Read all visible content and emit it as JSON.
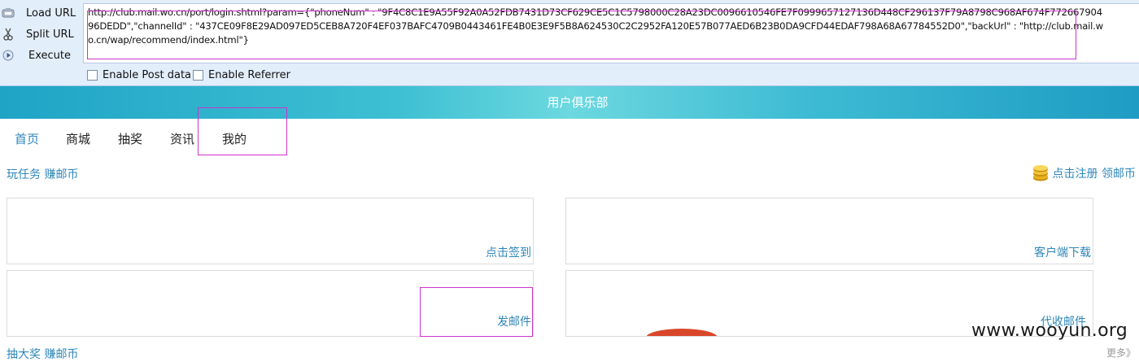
{
  "toolbar": {
    "load_url_label": "Load URL",
    "split_url_label": "Split URL",
    "execute_label": "Execute",
    "url_value": "http://club.mail.wo.cn/port/login.shtml?param={\"phoneNum\" : \"9F4C8C1E9A55F92A0A52FDB7431D73CF629CE5C1C5798000C28A23DC0096610546FE7F0999657127136D448CF296137F79A8798C968AF674F77266790496DEDD\",\"channelId\" : \"437CE09F8E29AD097ED5CEB8A720F4EF037BAFC4709B0443461FE4B0E3E9F5B8A624530C2C2952FA120E57B077AED6B23B0DA9CFD44EDAF798A68A67784552D0\",\"backUrl\" : \"http://club.mail.wo.cn/wap/recommend/index.html\"}",
    "enable_post_label": "Enable Post data",
    "enable_referrer_label": "Enable Referrer"
  },
  "header": {
    "title": "用户俱乐部"
  },
  "nav": {
    "items": [
      "首页",
      "商城",
      "抽奖",
      "资讯",
      "我的"
    ]
  },
  "sections": {
    "task_title": "玩任务 赚邮币",
    "register_link": "点击注册 领邮币",
    "lottery_title": "抽大奖 赚邮币",
    "more_link": "更多》"
  },
  "cards": {
    "checkin": "点击签到",
    "download": "客户端下载",
    "send_mail": "发邮件",
    "collect_mail": "代收邮件"
  },
  "watermark": "www.wooyun.org",
  "colors": {
    "link_blue": "#2e86b8",
    "highlight_box": "#cc33cc",
    "banner_teal": "#3ec0d3",
    "toolbar_bg": "#e3eefb"
  },
  "icons": {
    "load": "load-url-icon",
    "split": "scissors-icon",
    "execute": "play-icon",
    "coins": "coins-icon"
  }
}
